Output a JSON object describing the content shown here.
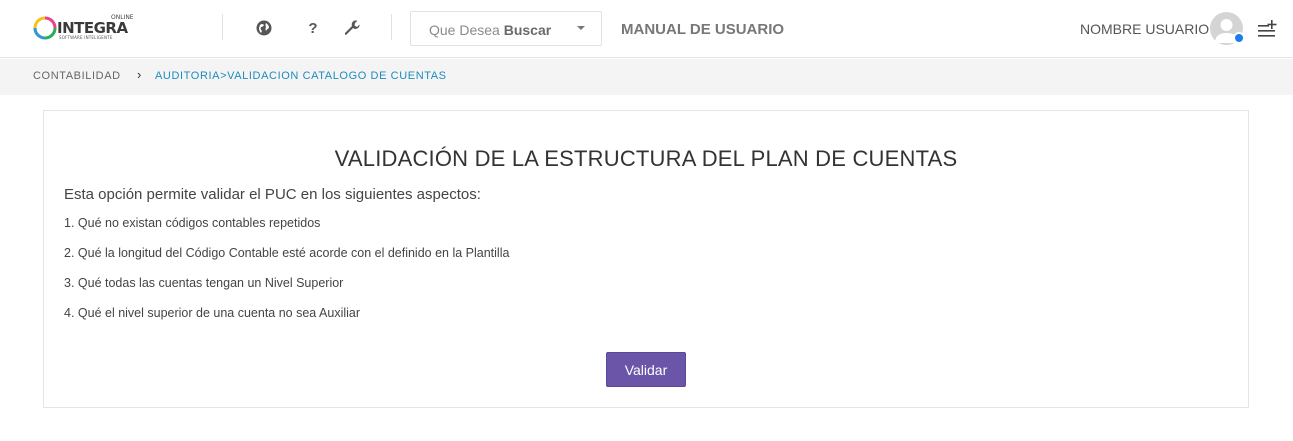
{
  "header": {
    "logo": {
      "online": "ONLINE",
      "brand": "INTEGRA",
      "tagline": "SOFTWARE INTELIGENTE"
    },
    "icons": [
      "globe-icon",
      "help-icon",
      "wrench-icon"
    ],
    "help_glyph": "?",
    "search": {
      "label": "Que Desea",
      "label_bold": "Buscar"
    },
    "manual_link": "MANUAL DE USUARIO",
    "user_name": "NOMBRE USUARIO",
    "status_color": "#1a7fe8"
  },
  "breadcrumb": {
    "root": "CONTABILIDAD",
    "separator": "›",
    "current": "AUDITORIA>VALIDACION CATALOGO DE CUENTAS"
  },
  "content": {
    "title": "VALIDACIÓN DE LA ESTRUCTURA DEL PLAN DE CUENTAS",
    "intro": "Esta opción permite validar el PUC en los siguientes aspectos:",
    "items": [
      "1. Qué no existan códigos contables repetidos",
      "2. Qué la longitud del Código Contable esté acorde con el definido en la Plantilla",
      "3. Qué todas las cuentas tengan un Nivel Superior",
      "4. Qué el nivel superior de una cuenta no sea Auxiliar"
    ],
    "button_label": "Validar",
    "button_color": "#6b55a8"
  }
}
